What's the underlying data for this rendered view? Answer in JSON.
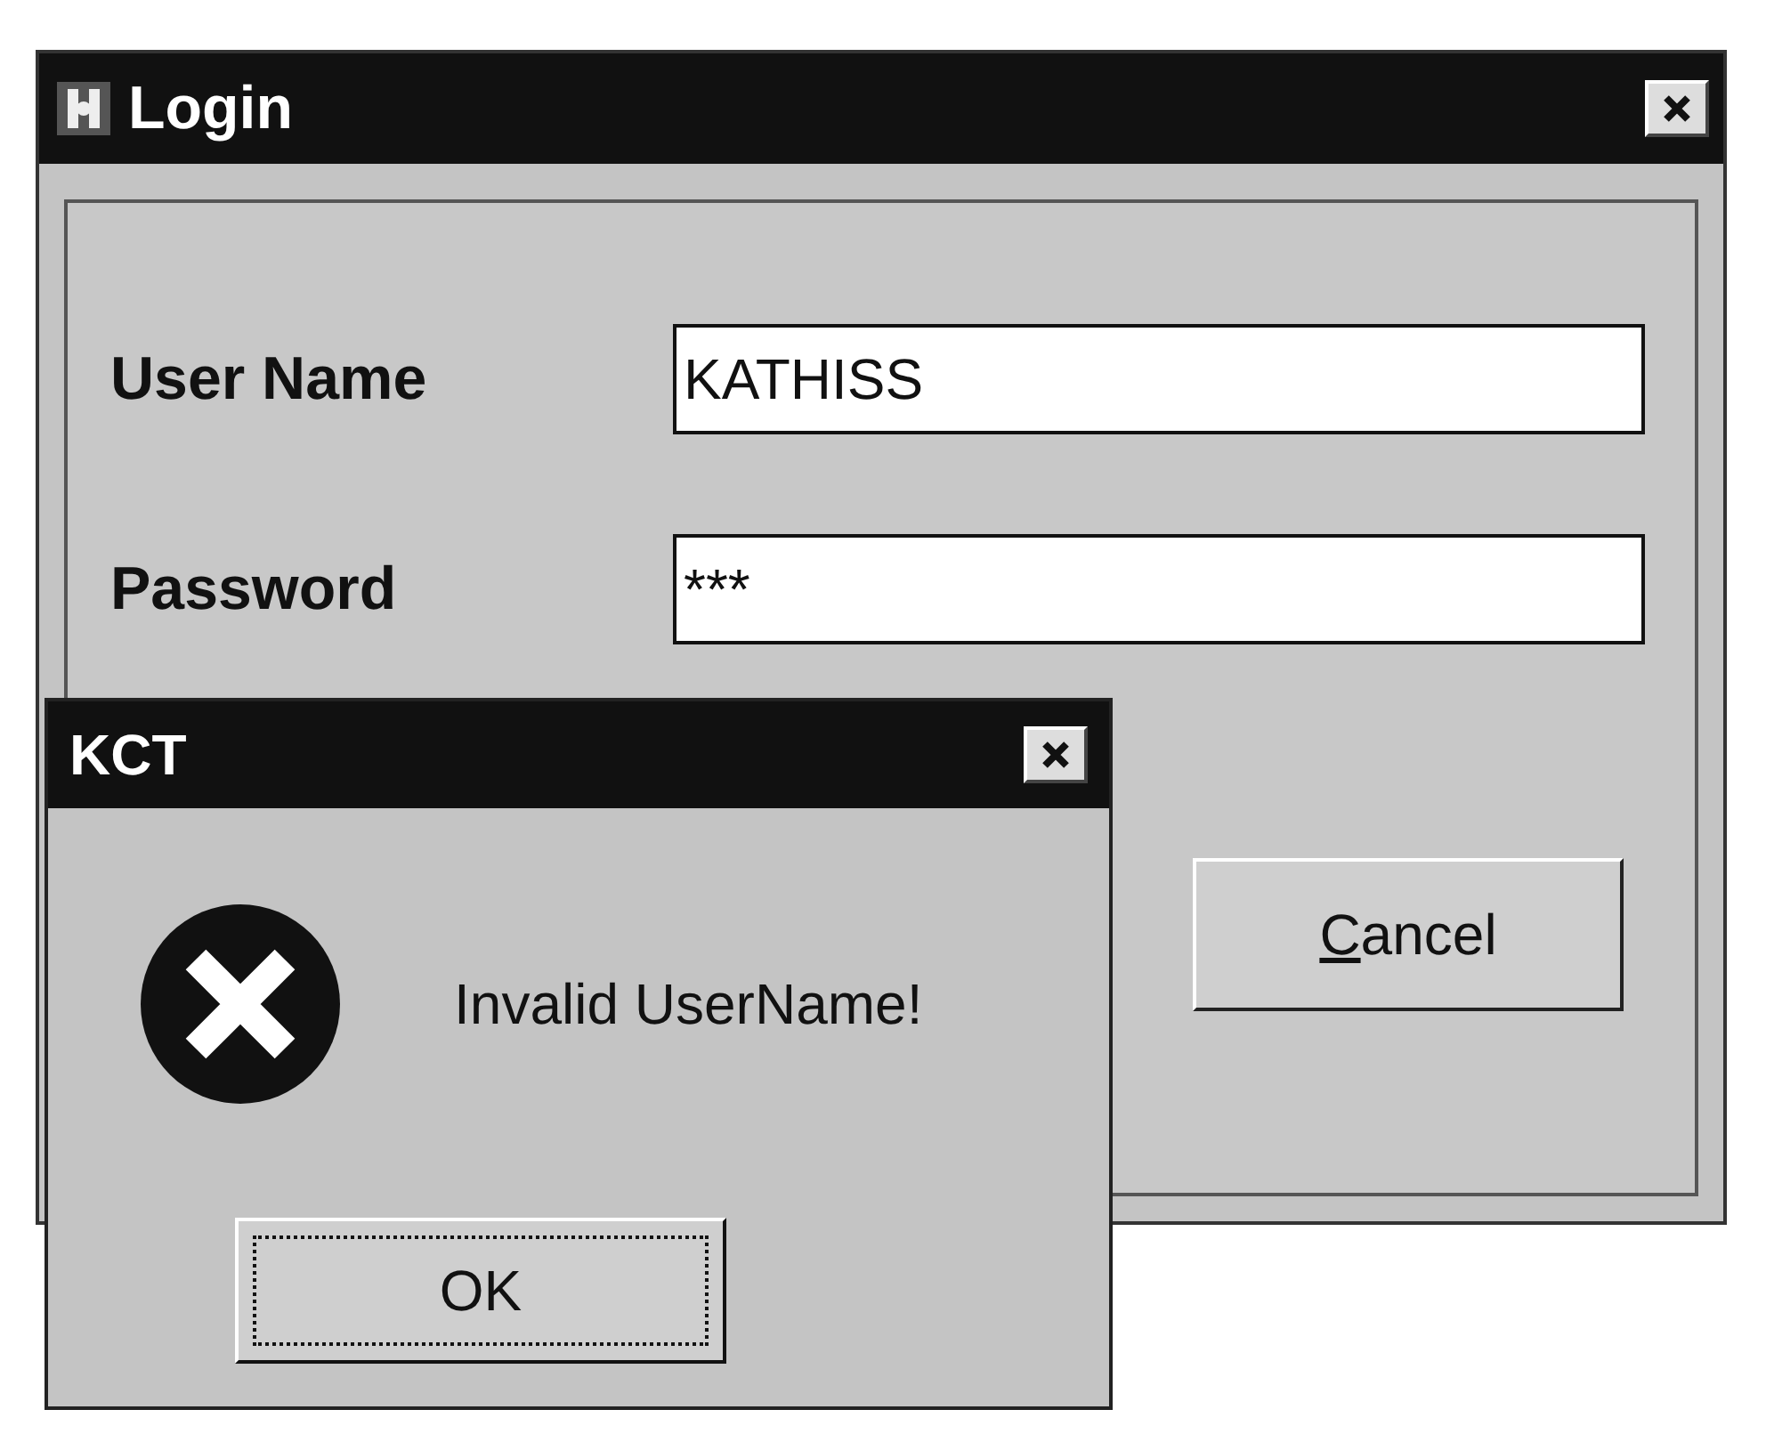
{
  "login_window": {
    "title": "Login",
    "fields": [
      {
        "label": "User Name",
        "value": "KATHISS"
      },
      {
        "label": "Password",
        "value": "***"
      }
    ],
    "buttons": [
      {
        "label": "Cancel"
      }
    ]
  },
  "message_dialog": {
    "title": "KCT",
    "message": "Invalid UserName!",
    "buttons": [
      {
        "label": "OK",
        "focused": true
      }
    ]
  }
}
